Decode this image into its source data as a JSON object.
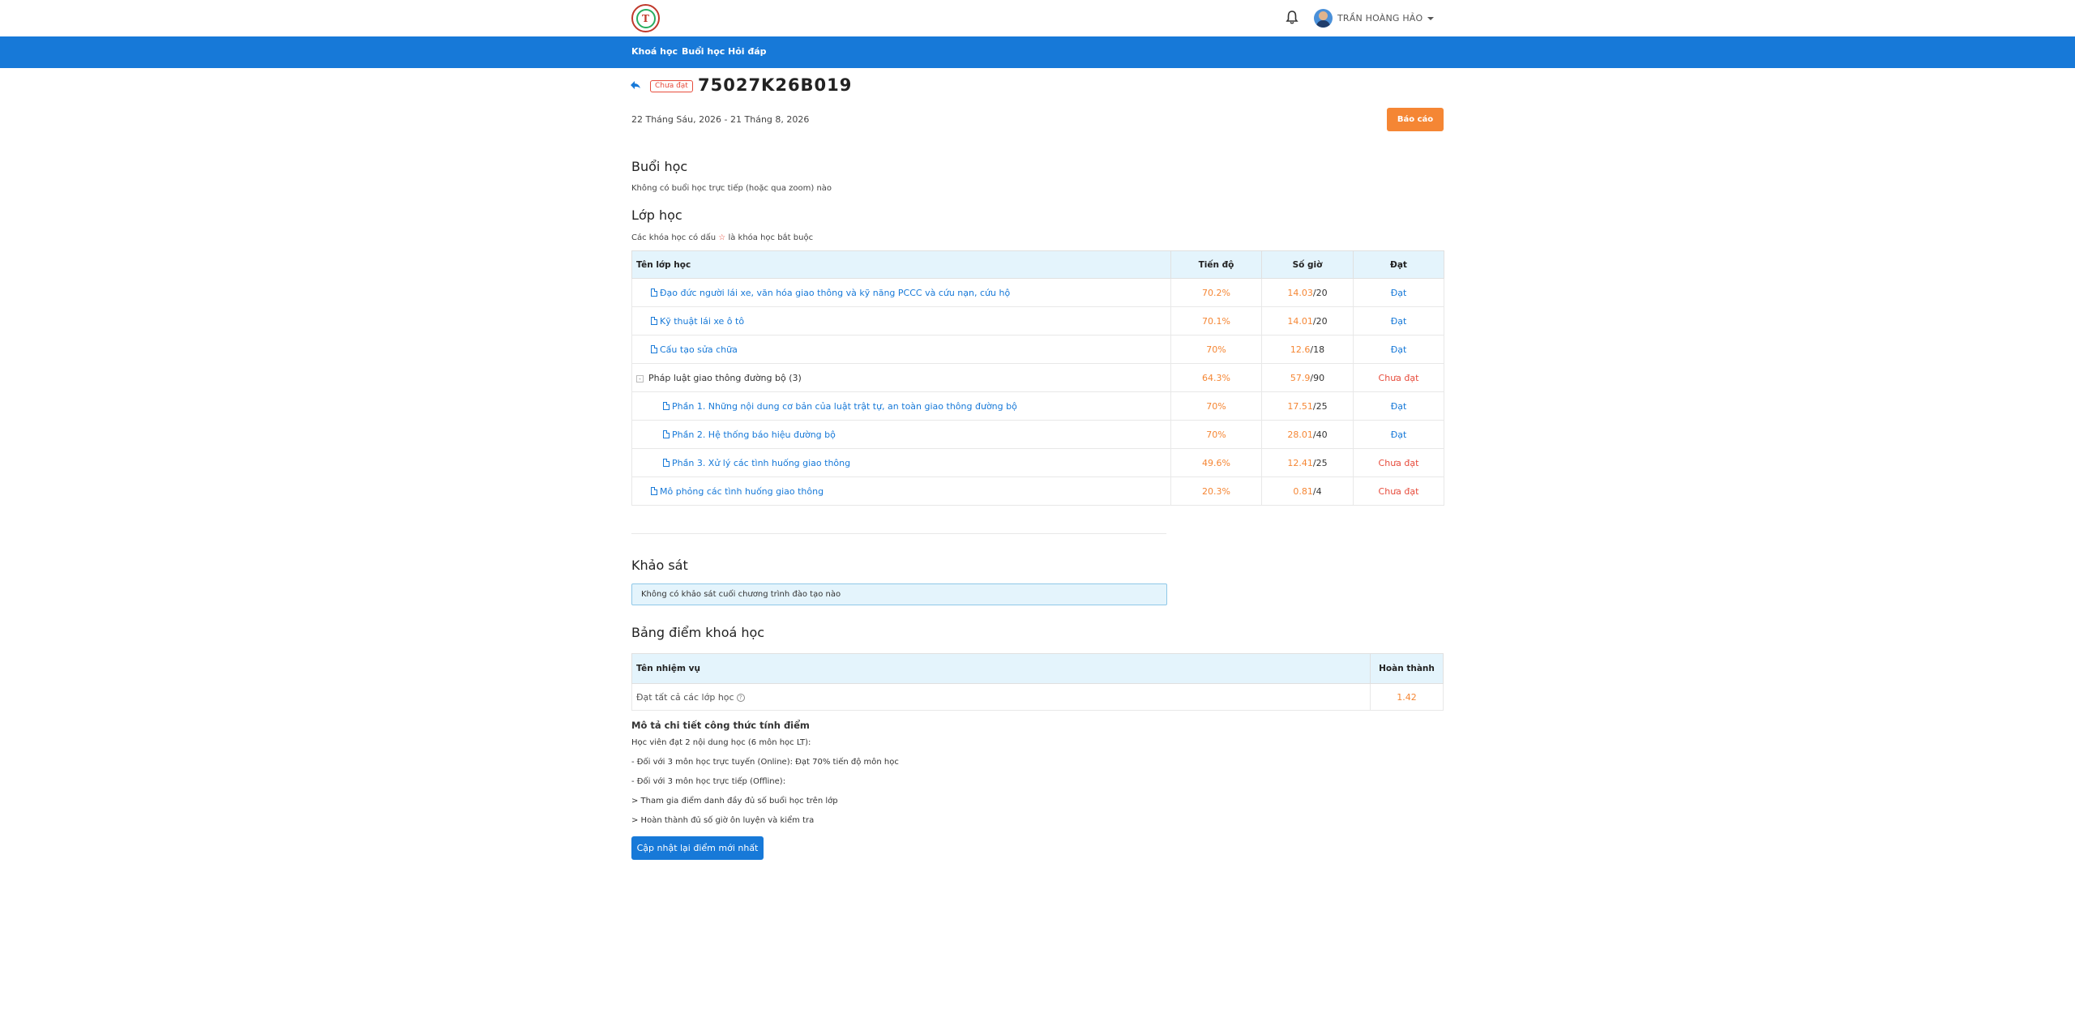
{
  "header": {
    "user_name": "TRẦN HOÀNG HẢO",
    "icons": {
      "logo": "school-logo",
      "bell": "bell-icon",
      "avatar": "user-avatar"
    }
  },
  "nav": {
    "items": [
      {
        "label": "Khoá học"
      },
      {
        "label": "Buổi học"
      },
      {
        "label": "Hỏi đáp"
      }
    ]
  },
  "course": {
    "status": "Chưa đạt",
    "code": "75027K26B019",
    "date_range": "22 Tháng Sáu, 2026 - 21 Tháng 8, 2026",
    "report_label": "Báo cáo"
  },
  "sessions": {
    "heading": "Buổi học",
    "empty_text": "Không có buổi học trực tiếp (hoặc qua zoom) nào"
  },
  "classes": {
    "heading": "Lớp học",
    "note_before": "Các khóa học có dấu",
    "note_star": "☆",
    "note_after": "là khóa học bắt buộc",
    "columns": {
      "name": "Tên lớp học",
      "progress": "Tiến độ",
      "hours": "Số giờ",
      "pass": "Đạt"
    },
    "rows": [
      {
        "name": "Đạo đức người lái xe, văn hóa giao thông và kỹ năng PCCC và cứu nạn, cứu hộ",
        "progress": "70.2%",
        "hours_done": "14.03",
        "hours_total": "/20",
        "pass": "Đạt",
        "passed": true,
        "level": 1,
        "type": "course"
      },
      {
        "name": "Kỹ thuật lái xe ô tô",
        "progress": "70.1%",
        "hours_done": "14.01",
        "hours_total": "/20",
        "pass": "Đạt",
        "passed": true,
        "level": 1,
        "type": "course"
      },
      {
        "name": "Cấu tạo sửa chữa",
        "progress": "70%",
        "hours_done": "12.6",
        "hours_total": "/18",
        "pass": "Đạt",
        "passed": true,
        "level": 1,
        "type": "course"
      },
      {
        "name": "Pháp luật giao thông đường bộ",
        "count": "(3)",
        "toggle": "-",
        "progress": "64.3%",
        "hours_done": "57.9",
        "hours_total": "/90",
        "pass": "Chưa đạt",
        "passed": false,
        "level": 0,
        "type": "group"
      },
      {
        "name": "Phần 1. Những nội dung cơ bản của luật trật tự, an toàn giao thông đường bộ",
        "progress": "70%",
        "hours_done": "17.51",
        "hours_total": "/25",
        "pass": "Đạt",
        "passed": true,
        "level": 2,
        "type": "course"
      },
      {
        "name": "Phần 2. Hệ thống báo hiệu đường bộ",
        "progress": "70%",
        "hours_done": "28.01",
        "hours_total": "/40",
        "pass": "Đạt",
        "passed": true,
        "level": 2,
        "type": "course"
      },
      {
        "name": "Phần 3. Xử lý các tình huống giao thông",
        "progress": "49.6%",
        "hours_done": "12.41",
        "hours_total": "/25",
        "pass": "Chưa đạt",
        "passed": false,
        "level": 2,
        "type": "course"
      },
      {
        "name": "Mô phỏng các tình huống giao thông",
        "progress": "20.3%",
        "hours_done": "0.81",
        "hours_total": "/4",
        "pass": "Chưa đạt",
        "passed": false,
        "level": 1,
        "type": "course"
      }
    ]
  },
  "survey": {
    "heading": "Khảo sát",
    "empty_text": "Không có khảo sát cuối chương trình đào tạo nào"
  },
  "scores": {
    "heading": "Bảng điểm khoá học",
    "columns": {
      "task": "Tên nhiệm vụ",
      "done": "Hoàn thành"
    },
    "rows": [
      {
        "task": "Đạt tất cả các lớp học",
        "value": "1.42"
      }
    ]
  },
  "formula": {
    "title": "Mô tả chi tiết công thức tính điểm",
    "lines": [
      "Học viên đạt 2 nội dung học (6 môn học LT):",
      "- Đối với 3 môn học trực tuyến (Online): Đạt 70% tiến độ môn học",
      "- Đối với 3 môn học trực tiếp (Offline):",
      "> Tham gia điểm danh đầy đủ số buổi học trên lớp",
      "> Hoàn thành đủ số giờ ôn luyện và kiểm tra"
    ],
    "update_label": "Cập nhật lại điểm mới nhất"
  }
}
